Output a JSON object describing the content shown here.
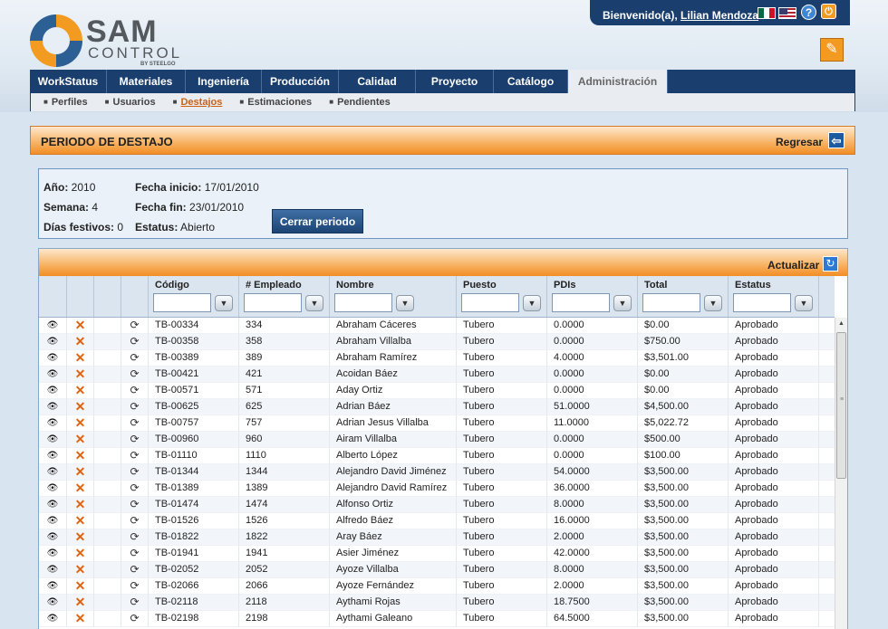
{
  "welcome": {
    "prefix": "Bienvenido(a),",
    "user": "Lilian Mendoza",
    "help": "?",
    "power": "⏻"
  },
  "logo": {
    "sam": "SAM",
    "control": "CONTROL",
    "by": "BY STEELGO"
  },
  "nav": {
    "tabs": [
      "WorkStatus",
      "Materiales",
      "Ingeniería",
      "Producción",
      "Calidad",
      "Proyecto",
      "Catálogo",
      "Administración"
    ],
    "subtabs": [
      "Perfiles",
      "Usuarios",
      "Destajos",
      "Estimaciones",
      "Pendientes"
    ]
  },
  "section": {
    "title": "PERIODO DE DESTAJO",
    "back": "Regresar"
  },
  "info": {
    "year_label": "Año:",
    "year": "2010",
    "week_label": "Semana:",
    "week": "4",
    "holidays_label": "Días festivos:",
    "holidays": "0",
    "start_label": "Fecha inicio:",
    "start": "17/01/2010",
    "end_label": "Fecha fin:",
    "end": "23/01/2010",
    "status_label": "Estatus:",
    "status": "Abierto",
    "close_button": "Cerrar periodo"
  },
  "grid": {
    "refresh": "Actualizar",
    "columns": [
      "Código",
      "# Empleado",
      "Nombre",
      "Puesto",
      "PDIs",
      "Total",
      "Estatus"
    ],
    "rows": [
      [
        "TB-00334",
        "334",
        "Abraham Cáceres",
        "Tubero",
        "0.0000",
        "$0.00",
        "Aprobado"
      ],
      [
        "TB-00358",
        "358",
        "Abraham Villalba",
        "Tubero",
        "0.0000",
        "$750.00",
        "Aprobado"
      ],
      [
        "TB-00389",
        "389",
        "Abraham Ramírez",
        "Tubero",
        "4.0000",
        "$3,501.00",
        "Aprobado"
      ],
      [
        "TB-00421",
        "421",
        "Acoidan Báez",
        "Tubero",
        "0.0000",
        "$0.00",
        "Aprobado"
      ],
      [
        "TB-00571",
        "571",
        "Aday Ortiz",
        "Tubero",
        "0.0000",
        "$0.00",
        "Aprobado"
      ],
      [
        "TB-00625",
        "625",
        "Adrian Báez",
        "Tubero",
        "51.0000",
        "$4,500.00",
        "Aprobado"
      ],
      [
        "TB-00757",
        "757",
        "Adrian Jesus Villalba",
        "Tubero",
        "11.0000",
        "$5,022.72",
        "Aprobado"
      ],
      [
        "TB-00960",
        "960",
        "Airam Villalba",
        "Tubero",
        "0.0000",
        "$500.00",
        "Aprobado"
      ],
      [
        "TB-01110",
        "1110",
        "Alberto López",
        "Tubero",
        "0.0000",
        "$100.00",
        "Aprobado"
      ],
      [
        "TB-01344",
        "1344",
        "Alejandro David Jiménez",
        "Tubero",
        "54.0000",
        "$3,500.00",
        "Aprobado"
      ],
      [
        "TB-01389",
        "1389",
        "Alejandro David Ramírez",
        "Tubero",
        "36.0000",
        "$3,500.00",
        "Aprobado"
      ],
      [
        "TB-01474",
        "1474",
        "Alfonso Ortiz",
        "Tubero",
        "8.0000",
        "$3,500.00",
        "Aprobado"
      ],
      [
        "TB-01526",
        "1526",
        "Alfredo Báez",
        "Tubero",
        "16.0000",
        "$3,500.00",
        "Aprobado"
      ],
      [
        "TB-01822",
        "1822",
        "Aray Báez",
        "Tubero",
        "2.0000",
        "$3,500.00",
        "Aprobado"
      ],
      [
        "TB-01941",
        "1941",
        "Asier Jiménez",
        "Tubero",
        "42.0000",
        "$3,500.00",
        "Aprobado"
      ],
      [
        "TB-02052",
        "2052",
        "Ayoze Villalba",
        "Tubero",
        "8.0000",
        "$3,500.00",
        "Aprobado"
      ],
      [
        "TB-02066",
        "2066",
        "Ayoze Fernández",
        "Tubero",
        "2.0000",
        "$3,500.00",
        "Aprobado"
      ],
      [
        "TB-02118",
        "2118",
        "Aythami Rojas",
        "Tubero",
        "18.7500",
        "$3,500.00",
        "Aprobado"
      ],
      [
        "TB-02198",
        "2198",
        "Aythami Galeano",
        "Tubero",
        "64.5000",
        "$3,500.00",
        "Aprobado"
      ]
    ]
  },
  "icons": {
    "view": "eye-icon",
    "delete": "delete-x-icon",
    "recalc": "refresh-cycle-icon",
    "filter": "filter-icon"
  },
  "colors": {
    "nav": "#1a3f6f",
    "accent_orange": "#f28d25",
    "link_orange": "#c8621a"
  }
}
